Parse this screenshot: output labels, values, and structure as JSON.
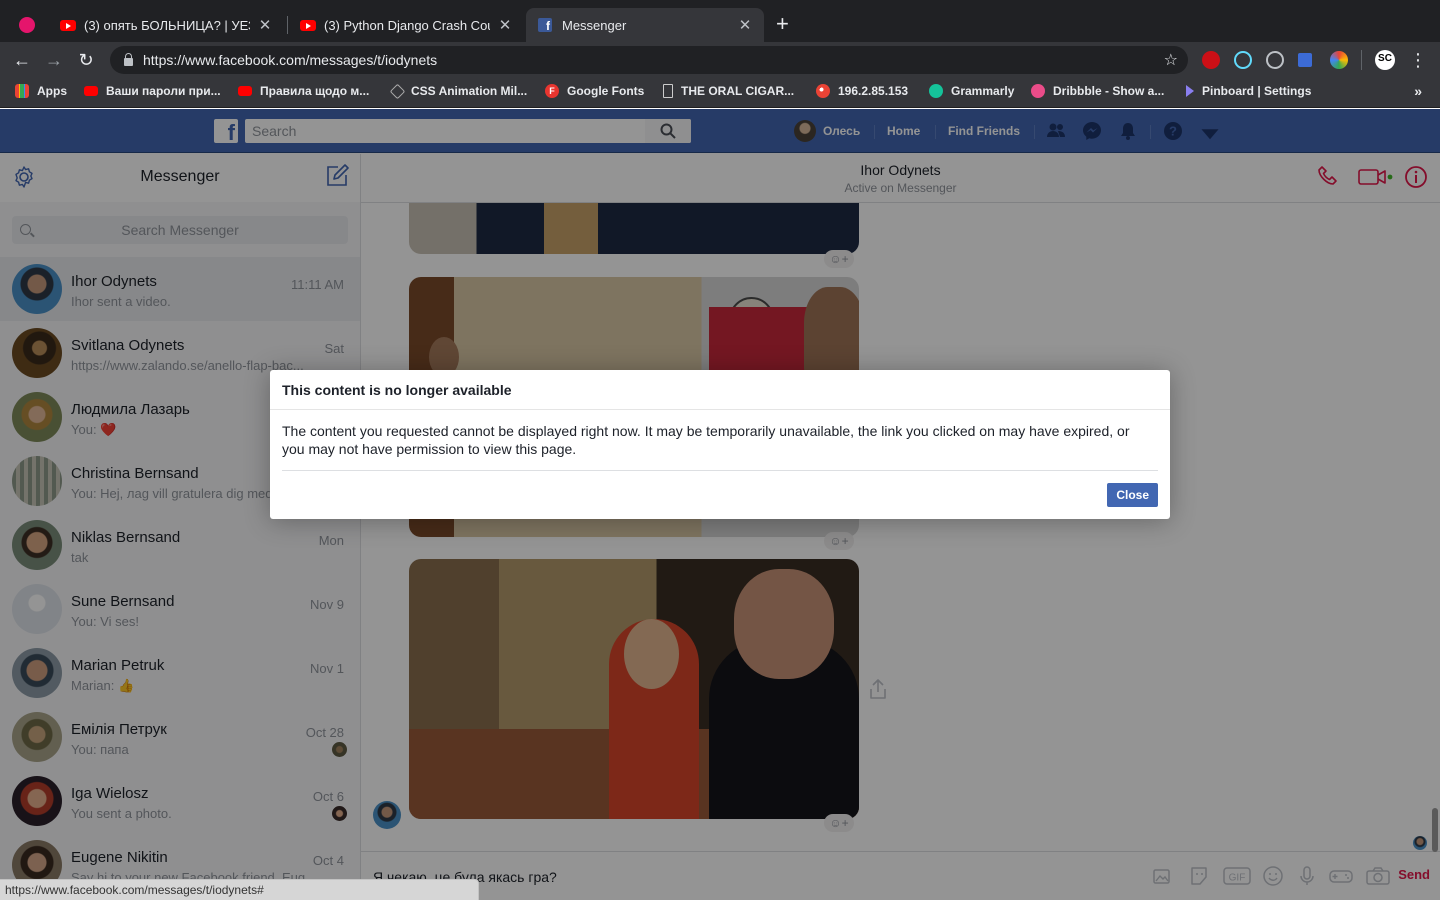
{
  "browser": {
    "tabs": [
      {
        "title": "(3) опять БОЛЬНИЦА? | УЕЗЖ",
        "icon": "youtube-icon"
      },
      {
        "title": "(3) Python Django Crash Cours",
        "icon": "youtube-icon"
      },
      {
        "title": "Messenger",
        "icon": "facebook-icon"
      }
    ],
    "close_glyph": "✕",
    "new_tab_glyph": "+",
    "url": "https://www.facebook.com/messages/t/iodynets",
    "bookmarks": [
      {
        "label": "Apps",
        "icon": "apps-icon"
      },
      {
        "label": "Ваши пароли при...",
        "icon": "youtube-icon"
      },
      {
        "label": "Правила щодо м...",
        "icon": "youtube-icon"
      },
      {
        "label": "CSS Animation Mil...",
        "icon": "cube-icon"
      },
      {
        "label": "Google Fonts",
        "icon": "google-fonts-icon"
      },
      {
        "label": "THE ORAL CIGAR...",
        "icon": "document-icon"
      },
      {
        "label": "196.2.85.153",
        "icon": "cdn-icon"
      },
      {
        "label": "Grammarly",
        "icon": "grammarly-icon"
      },
      {
        "label": "Dribbble - Show a...",
        "icon": "dribbble-icon"
      },
      {
        "label": "Pinboard | Settings",
        "icon": "pinboard-icon"
      }
    ],
    "bookmarks_more": "»",
    "status_url": "https://www.facebook.com/messages/t/iodynets#"
  },
  "facebook": {
    "search_placeholder": "Search",
    "user_name": "Олесь",
    "home_label": "Home",
    "find_friends_label": "Find Friends",
    "brand_color": "#4267b2"
  },
  "messenger": {
    "title": "Messenger",
    "search_placeholder": "Search Messenger",
    "conversations": [
      {
        "name": "Ihor Odynets",
        "snippet": "Ihor sent a video.",
        "time": "11:11 AM",
        "active": true
      },
      {
        "name": "Svitlana Odynets",
        "snippet": "https://www.zalando.se/anello-flap-bac...",
        "time": "Sat"
      },
      {
        "name": "Людмила Лазарь",
        "snippet": "You: ❤️",
        "time": ""
      },
      {
        "name": "Christina Bernsand",
        "snippet": "You: Hej, лаg vill gratulera dig med...",
        "time": ""
      },
      {
        "name": "Niklas Bernsand",
        "snippet": "tak",
        "time": "Mon"
      },
      {
        "name": "Sune Bernsand",
        "snippet": "You: Vi ses!",
        "time": "Nov 9"
      },
      {
        "name": "Marian Petruk",
        "snippet": "Marian: 👍",
        "time": "Nov 1"
      },
      {
        "name": "Емілія Петрук",
        "snippet": "You: папа",
        "time": "Oct 28"
      },
      {
        "name": "Iga Wielosz",
        "snippet": "You sent a photo.",
        "time": "Oct 6"
      },
      {
        "name": "Eugene Nikitin",
        "snippet": "Say hi to your new Facebook friend, Eug...",
        "time": "Oct 4"
      }
    ]
  },
  "conversation": {
    "contact_name": "Ihor Odynets",
    "status": "Active on Messenger",
    "composer_text": "Я чекаю, це була якась гра?",
    "send_label": "Send",
    "accent_color": "#e3174a"
  },
  "dialog": {
    "title": "This content is no longer available",
    "body": "The content you requested cannot be displayed right now. It may be temporarily unavailable, the link you clicked on may have expired, or you may not have permission to view this page.",
    "close_label": "Close"
  }
}
